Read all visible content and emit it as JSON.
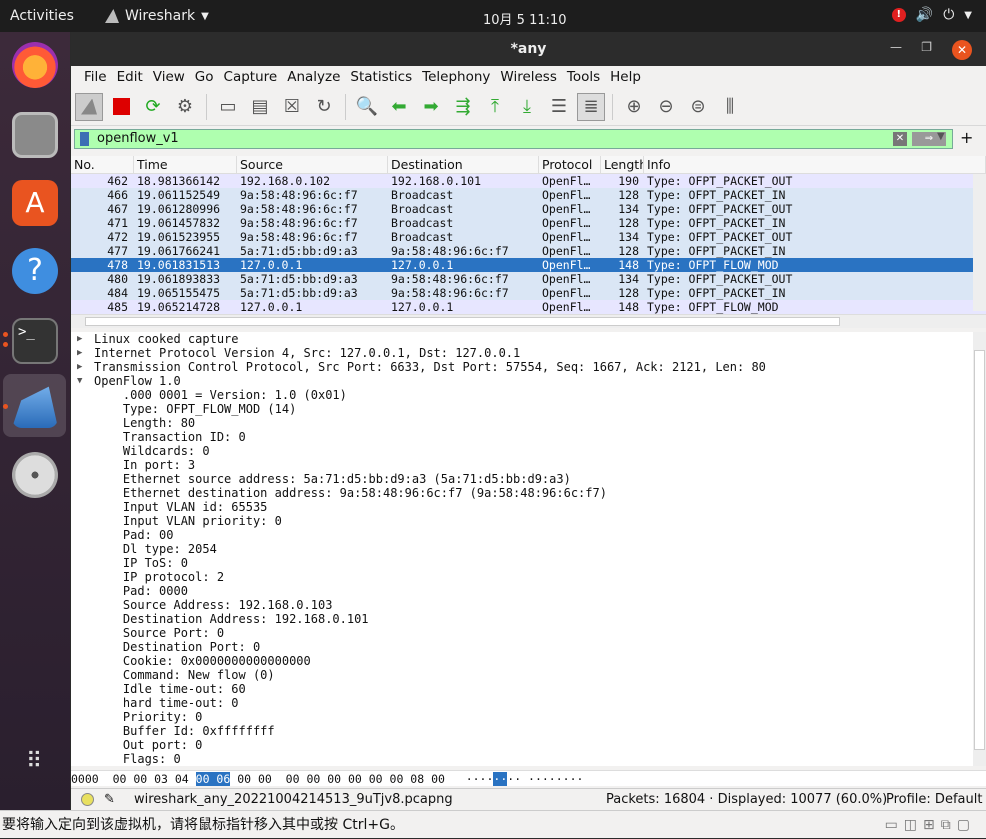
{
  "topbar": {
    "activities": "Activities",
    "app": "Wireshark",
    "clock": "10月 5  11:10",
    "alert": "!"
  },
  "window": {
    "title": "*any"
  },
  "menu": [
    "File",
    "Edit",
    "View",
    "Go",
    "Capture",
    "Analyze",
    "Statistics",
    "Telephony",
    "Wireless",
    "Tools",
    "Help"
  ],
  "filter": {
    "value": "openflow_v1"
  },
  "columns": [
    "No.",
    "Time",
    "Source",
    "Destination",
    "Protocol",
    "Length",
    "Info"
  ],
  "packets": [
    {
      "no": "462",
      "time": "18.981366142",
      "src": "192.168.0.102",
      "dst": "192.168.0.101",
      "proto": "OpenFl…",
      "len": "190",
      "info": "Type: OFPT_PACKET_OUT"
    },
    {
      "no": "466",
      "time": "19.061152549",
      "src": "9a:58:48:96:6c:f7",
      "dst": "Broadcast",
      "proto": "OpenFl…",
      "len": "128",
      "info": "Type: OFPT_PACKET_IN"
    },
    {
      "no": "467",
      "time": "19.061280996",
      "src": "9a:58:48:96:6c:f7",
      "dst": "Broadcast",
      "proto": "OpenFl…",
      "len": "134",
      "info": "Type: OFPT_PACKET_OUT"
    },
    {
      "no": "471",
      "time": "19.061457832",
      "src": "9a:58:48:96:6c:f7",
      "dst": "Broadcast",
      "proto": "OpenFl…",
      "len": "128",
      "info": "Type: OFPT_PACKET_IN"
    },
    {
      "no": "472",
      "time": "19.061523955",
      "src": "9a:58:48:96:6c:f7",
      "dst": "Broadcast",
      "proto": "OpenFl…",
      "len": "134",
      "info": "Type: OFPT_PACKET_OUT"
    },
    {
      "no": "477",
      "time": "19.061766241",
      "src": "5a:71:d5:bb:d9:a3",
      "dst": "9a:58:48:96:6c:f7",
      "proto": "OpenFl…",
      "len": "128",
      "info": "Type: OFPT_PACKET_IN"
    },
    {
      "no": "478",
      "time": "19.061831513",
      "src": "127.0.0.1",
      "dst": "127.0.0.1",
      "proto": "OpenFl…",
      "len": "148",
      "info": "Type: OFPT_FLOW_MOD"
    },
    {
      "no": "480",
      "time": "19.061893833",
      "src": "5a:71:d5:bb:d9:a3",
      "dst": "9a:58:48:96:6c:f7",
      "proto": "OpenFl…",
      "len": "134",
      "info": "Type: OFPT_PACKET_OUT"
    },
    {
      "no": "484",
      "time": "19.065155475",
      "src": "5a:71:d5:bb:d9:a3",
      "dst": "9a:58:48:96:6c:f7",
      "proto": "OpenFl…",
      "len": "128",
      "info": "Type: OFPT_PACKET_IN"
    },
    {
      "no": "485",
      "time": "19.065214728",
      "src": "127.0.0.1",
      "dst": "127.0.0.1",
      "proto": "OpenFl…",
      "len": "148",
      "info": "Type: OFPT_FLOW_MOD"
    }
  ],
  "details": [
    {
      "text": "Linux cooked capture",
      "collapsed": true
    },
    {
      "text": "Internet Protocol Version 4, Src: 127.0.0.1, Dst: 127.0.0.1",
      "collapsed": true
    },
    {
      "text": "Transmission Control Protocol, Src Port: 6633, Dst Port: 57554, Seq: 1667, Ack: 2121, Len: 80",
      "collapsed": true
    },
    {
      "text": "OpenFlow 1.0",
      "expanded": true
    },
    {
      "text": "    .000 0001 = Version: 1.0 (0x01)"
    },
    {
      "text": "    Type: OFPT_FLOW_MOD (14)"
    },
    {
      "text": "    Length: 80"
    },
    {
      "text": "    Transaction ID: 0"
    },
    {
      "text": "    Wildcards: 0"
    },
    {
      "text": "    In port: 3"
    },
    {
      "text": "    Ethernet source address: 5a:71:d5:bb:d9:a3 (5a:71:d5:bb:d9:a3)"
    },
    {
      "text": "    Ethernet destination address: 9a:58:48:96:6c:f7 (9a:58:48:96:6c:f7)"
    },
    {
      "text": "    Input VLAN id: 65535"
    },
    {
      "text": "    Input VLAN priority: 0"
    },
    {
      "text": "    Pad: 00"
    },
    {
      "text": "    Dl type: 2054"
    },
    {
      "text": "    IP ToS: 0"
    },
    {
      "text": "    IP protocol: 2"
    },
    {
      "text": "    Pad: 0000"
    },
    {
      "text": "    Source Address: 192.168.0.103"
    },
    {
      "text": "    Destination Address: 192.168.0.101"
    },
    {
      "text": "    Source Port: 0"
    },
    {
      "text": "    Destination Port: 0"
    },
    {
      "text": "    Cookie: 0x0000000000000000"
    },
    {
      "text": "    Command: New flow (0)"
    },
    {
      "text": "    Idle time-out: 60"
    },
    {
      "text": "    hard time-out: 0"
    },
    {
      "text": "    Priority: 0"
    },
    {
      "text": "    Buffer Id: 0xffffffff"
    },
    {
      "text": "    Out port: 0"
    },
    {
      "text": "    Flags: 0"
    }
  ],
  "hex": {
    "offset": "0000",
    "pre": "00 00 03 04 ",
    "hl": "00 06",
    "post": " 00 00  00 00 00 00 00 00 08 00",
    "ascii_pre": "····",
    "ascii_hl": "··",
    "ascii_post": "·· ········"
  },
  "status": {
    "file": "wireshark_any_20221004214513_9uTjv8.pcapng",
    "packets": "Packets: 16804 · Displayed: 10077 (60.0%)",
    "profile": "Profile: Default"
  },
  "bottom": {
    "hint": "要将输入定向到该虚拟机，请将鼠标指针移入其中或按 Ctrl+G。"
  }
}
